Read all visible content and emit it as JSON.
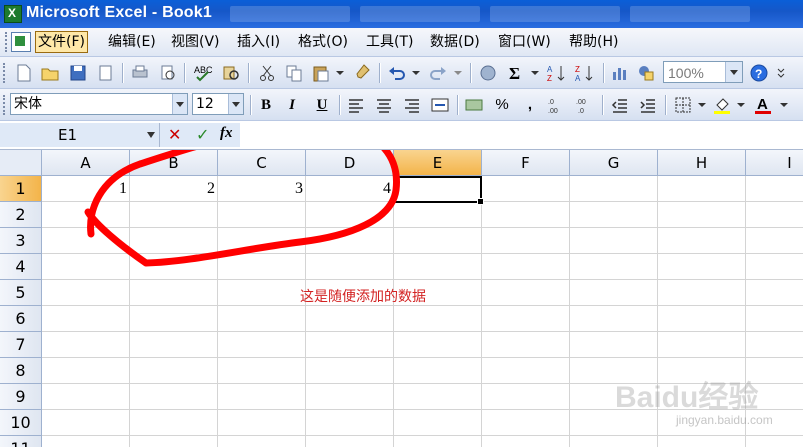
{
  "window": {
    "title": "Microsoft Excel - Book1"
  },
  "menubar": {
    "items": [
      {
        "label": "文件(F)",
        "active": true
      },
      {
        "label": "编辑(E)"
      },
      {
        "label": "视图(V)"
      },
      {
        "label": "插入(I)"
      },
      {
        "label": "格式(O)"
      },
      {
        "label": "工具(T)"
      },
      {
        "label": "数据(D)"
      },
      {
        "label": "窗口(W)"
      },
      {
        "label": "帮助(H)"
      }
    ]
  },
  "toolbar": {
    "zoom": "100%",
    "font_name": "宋体",
    "font_size": "12",
    "bold_label": "B",
    "italic_label": "I",
    "underline_label": "U",
    "percent_label": "%",
    "comma_label": ","
  },
  "formula_bar": {
    "name_box": "E1",
    "fx_label": "fx"
  },
  "sheet": {
    "columns": [
      "A",
      "B",
      "C",
      "D",
      "E",
      "F",
      "G",
      "H",
      "I"
    ],
    "rows": [
      "1",
      "2",
      "3",
      "4",
      "5",
      "6",
      "7",
      "8",
      "9",
      "10",
      "11"
    ],
    "row1_values": [
      "1",
      "2",
      "3",
      "4"
    ],
    "selected_cell": "E1",
    "note": "这是随便添加的数据"
  },
  "watermark": {
    "text": "Baidu经验",
    "url": "jingyan.baidu.com"
  },
  "colors": {
    "annotation_red": "#ff0000",
    "note_red": "#d32222",
    "selection_header": "#f3b44a"
  }
}
